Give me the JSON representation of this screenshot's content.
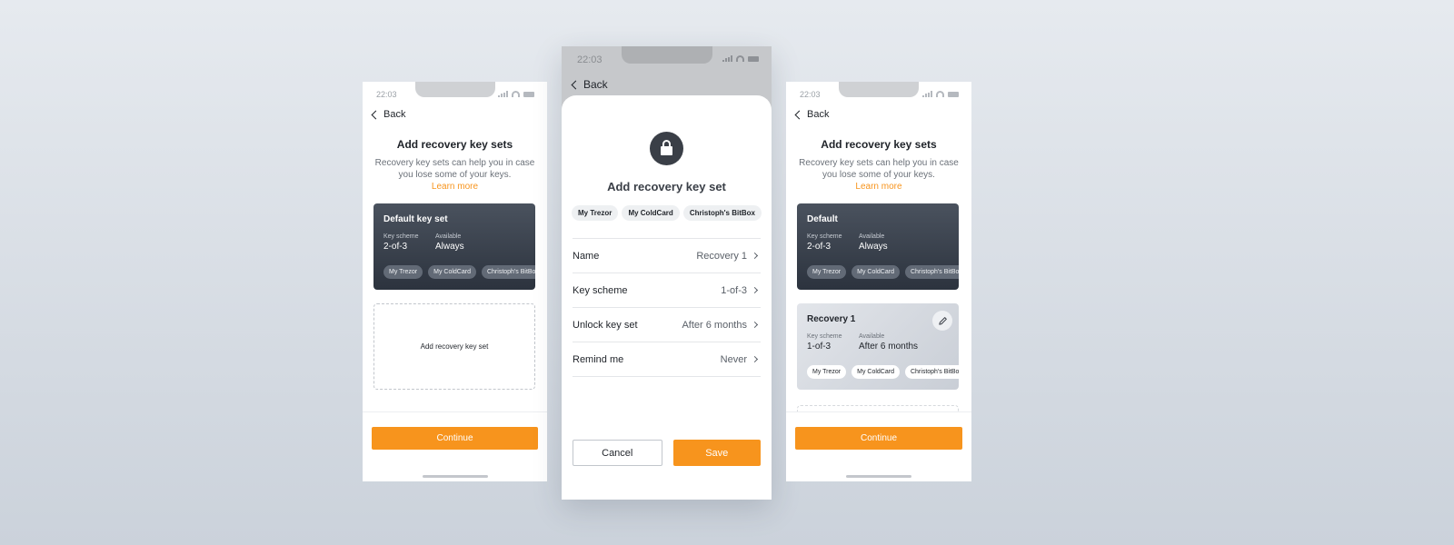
{
  "status_time": "22:03",
  "back_label": "Back",
  "left_screen": {
    "title": "Add recovery key sets",
    "description": "Recovery key sets can help you in case you lose some of your keys.",
    "learn_more": "Learn more",
    "default_card": {
      "title": "Default key set",
      "scheme_label": "Key scheme",
      "scheme_value": "2-of-3",
      "available_label": "Available",
      "available_value": "Always",
      "chips": [
        "My Trezor",
        "My ColdCard",
        "Christoph's BitBox"
      ]
    },
    "add_box_label": "Add recovery key set",
    "continue_label": "Continue"
  },
  "middle_screen": {
    "title": "Add recovery key set",
    "chips": [
      "My Trezor",
      "My ColdCard",
      "Christoph's BitBox"
    ],
    "rows": [
      {
        "label": "Name",
        "value": "Recovery 1"
      },
      {
        "label": "Key scheme",
        "value": "1-of-3"
      },
      {
        "label": "Unlock key set",
        "value": "After 6 months"
      },
      {
        "label": "Remind me",
        "value": "Never"
      }
    ],
    "cancel_label": "Cancel",
    "save_label": "Save"
  },
  "right_screen": {
    "title": "Add recovery key sets",
    "description": "Recovery key sets can help you in case you lose some of your keys.",
    "learn_more": "Learn more",
    "default_card": {
      "title": "Default",
      "scheme_label": "Key scheme",
      "scheme_value": "2-of-3",
      "available_label": "Available",
      "available_value": "Always",
      "chips": [
        "My Trezor",
        "My ColdCard",
        "Christoph's BitBox"
      ]
    },
    "recovery_card": {
      "title": "Recovery 1",
      "scheme_label": "Key scheme",
      "scheme_value": "1-of-3",
      "available_label": "Available",
      "available_value": "After 6 months",
      "chips": [
        "My Trezor",
        "My ColdCard",
        "Christoph's BitBox"
      ]
    },
    "continue_label": "Continue"
  },
  "colors": {
    "accent": "#f7941d",
    "card_dark": "#2c333e"
  }
}
